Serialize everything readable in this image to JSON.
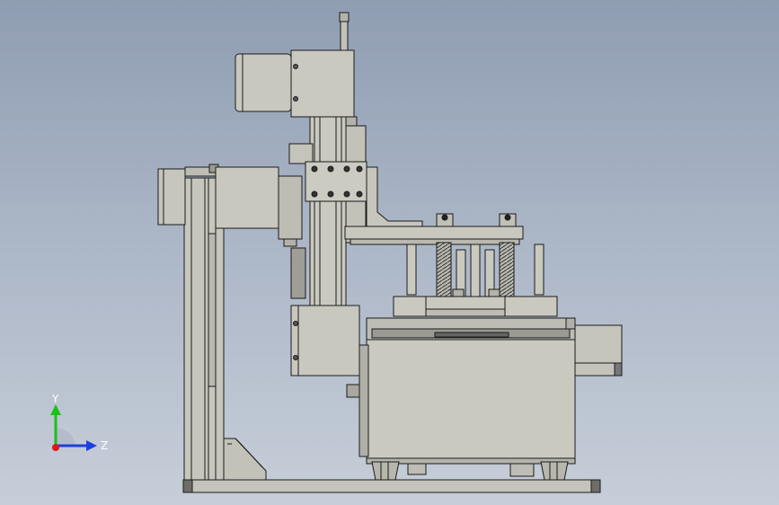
{
  "viewport": {
    "background_top": "#8f9db2",
    "background_bottom": "#c7ced9",
    "part_fill": "#c8c8bf",
    "part_stroke": "#1b1b1b"
  },
  "triad": {
    "y_label": "Y",
    "z_label": "Z",
    "y_color": "#19c219",
    "z_color": "#1d3fe0",
    "x_color": "#e01818",
    "icons": [
      "axis-triad-icon"
    ]
  }
}
